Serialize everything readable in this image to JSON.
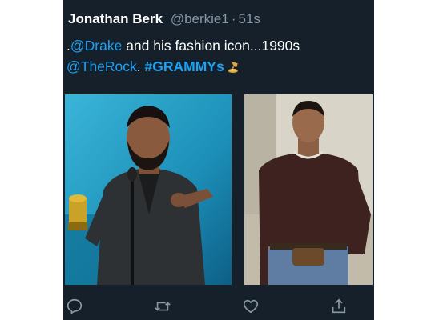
{
  "tweet": {
    "display_name": "Jonathan Berk",
    "handle": "@berkie1",
    "separator": "·",
    "time": "51s",
    "text_prefix": ".",
    "mention1": "@Drake",
    "text_mid": " and his fashion icon...1990s",
    "mention2": "@TheRock",
    "text_dot": ". ",
    "hashtag": "#GRAMMYs",
    "hashtag_emoji": "gramophone-emoji"
  },
  "media": {
    "left_photo": "drake-grammys-photo",
    "right_photo": "the-rock-1990s-photo"
  },
  "actions": [
    {
      "name": "reply",
      "icon": "speech-bubble-icon"
    },
    {
      "name": "retweet",
      "icon": "retweet-arrows-icon"
    },
    {
      "name": "like",
      "icon": "heart-icon"
    },
    {
      "name": "share",
      "icon": "share-upload-icon"
    }
  ],
  "colors": {
    "background": "#15202b",
    "link": "#1da1f2",
    "secondary_text": "#8899a6"
  }
}
